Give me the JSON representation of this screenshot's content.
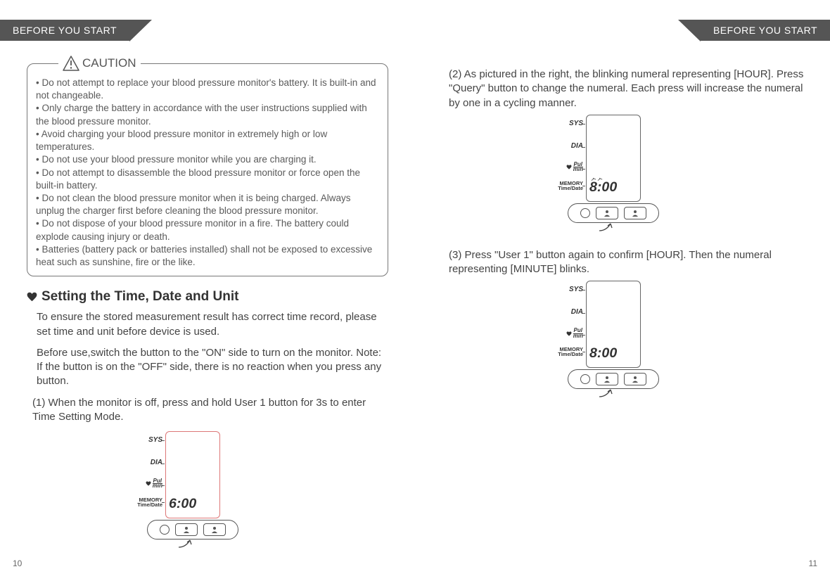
{
  "header": {
    "left": "BEFORE YOU START",
    "right": "BEFORE YOU START"
  },
  "caution": {
    "title": "CAUTION",
    "items": [
      "• Do not attempt to replace your blood pressure monitor's battery. It is built-in and not changeable.",
      "• Only charge the battery in accordance with the user instructions supplied with the blood pressure monitor.",
      "• Avoid charging your blood pressure monitor in extremely high or low temperatures.",
      "• Do not use your blood pressure monitor while you are charging it.",
      "• Do not attempt to disassemble the blood pressure monitor or force open the built-in battery.",
      "• Do not clean the blood pressure monitor when it is being charged. Always unplug the charger first before cleaning the blood pressure monitor.",
      "• Do not dispose of your blood pressure monitor in a fire. The battery could explode causing injury or death.",
      "• Batteries (battery pack or batteries installed) shall not be exposed to excessive heat such as sunshine, fire or the like."
    ]
  },
  "section_title": "Setting the Time, Date and Unit",
  "intro1": "To ensure the stored measurement result has correct time record, please set time and unit before device is used.",
  "intro2": "Before use,switch the button to the \"ON\" side to turn on the monitor. Note: If the button is on the \"OFF\" side, there is no reaction when you press any button.",
  "step1": "(1) When the monitor is off, press and hold User 1 button for 3s to enter Time Setting Mode.",
  "step2": "(2) As pictured in the right, the blinking numeral representing [HOUR]. Press \"Query\" button to change the numeral. Each press will increase the numeral by one in a cycling manner.",
  "step3": "(3) Press \"User 1\" button again to confirm [HOUR]. Then the numeral representing [MINUTE] blinks.",
  "labels": {
    "sys": "SYS",
    "dia": "DIA",
    "pul_top": "Pul",
    "pul_bot": "min",
    "mem1": "MEMORY",
    "mem2": "Time/Date"
  },
  "display": {
    "d1": "6:00",
    "d2": "8:00",
    "d3": "8:00"
  },
  "pages": {
    "left": "10",
    "right": "11"
  }
}
